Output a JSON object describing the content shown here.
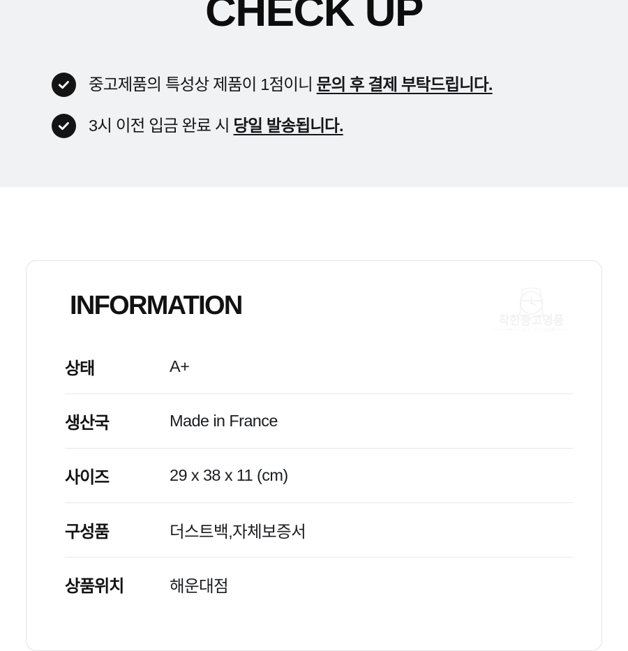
{
  "checkup": {
    "title": "CHECK UP",
    "items": [
      {
        "icon": "check-circle-icon",
        "lead": "중고제품의 특성상 제품이 1점이니 ",
        "emphasis": "문의 후 결제 부탁드립니다."
      },
      {
        "icon": "check-circle-icon",
        "lead": "3시 이전 입금 완료 시 ",
        "emphasis": "당일 발송됩니다."
      }
    ]
  },
  "information": {
    "heading": "INFORMATION",
    "watermark": {
      "icon": "watch-logo-icon",
      "brand": "착한중고명품",
      "tagline": "LUXURY GOODS"
    },
    "rows": [
      {
        "label": "상태",
        "value": "A+"
      },
      {
        "label": "생산국",
        "value": "Made in France"
      },
      {
        "label": "사이즈",
        "value": "29 x 38 x 11 (cm)"
      },
      {
        "label": "구성품",
        "value": "더스트백,자체보증서"
      },
      {
        "label": "상품위치",
        "value": "해운대점"
      }
    ]
  },
  "colors": {
    "banner_background": "#f1f2f4",
    "page_background": "#ffffff",
    "text": "#121212",
    "icon_fill": "#141414",
    "divider": "#e8e8ea",
    "card_border": "#e3e4e6",
    "watermark": "#f4f4f5"
  }
}
